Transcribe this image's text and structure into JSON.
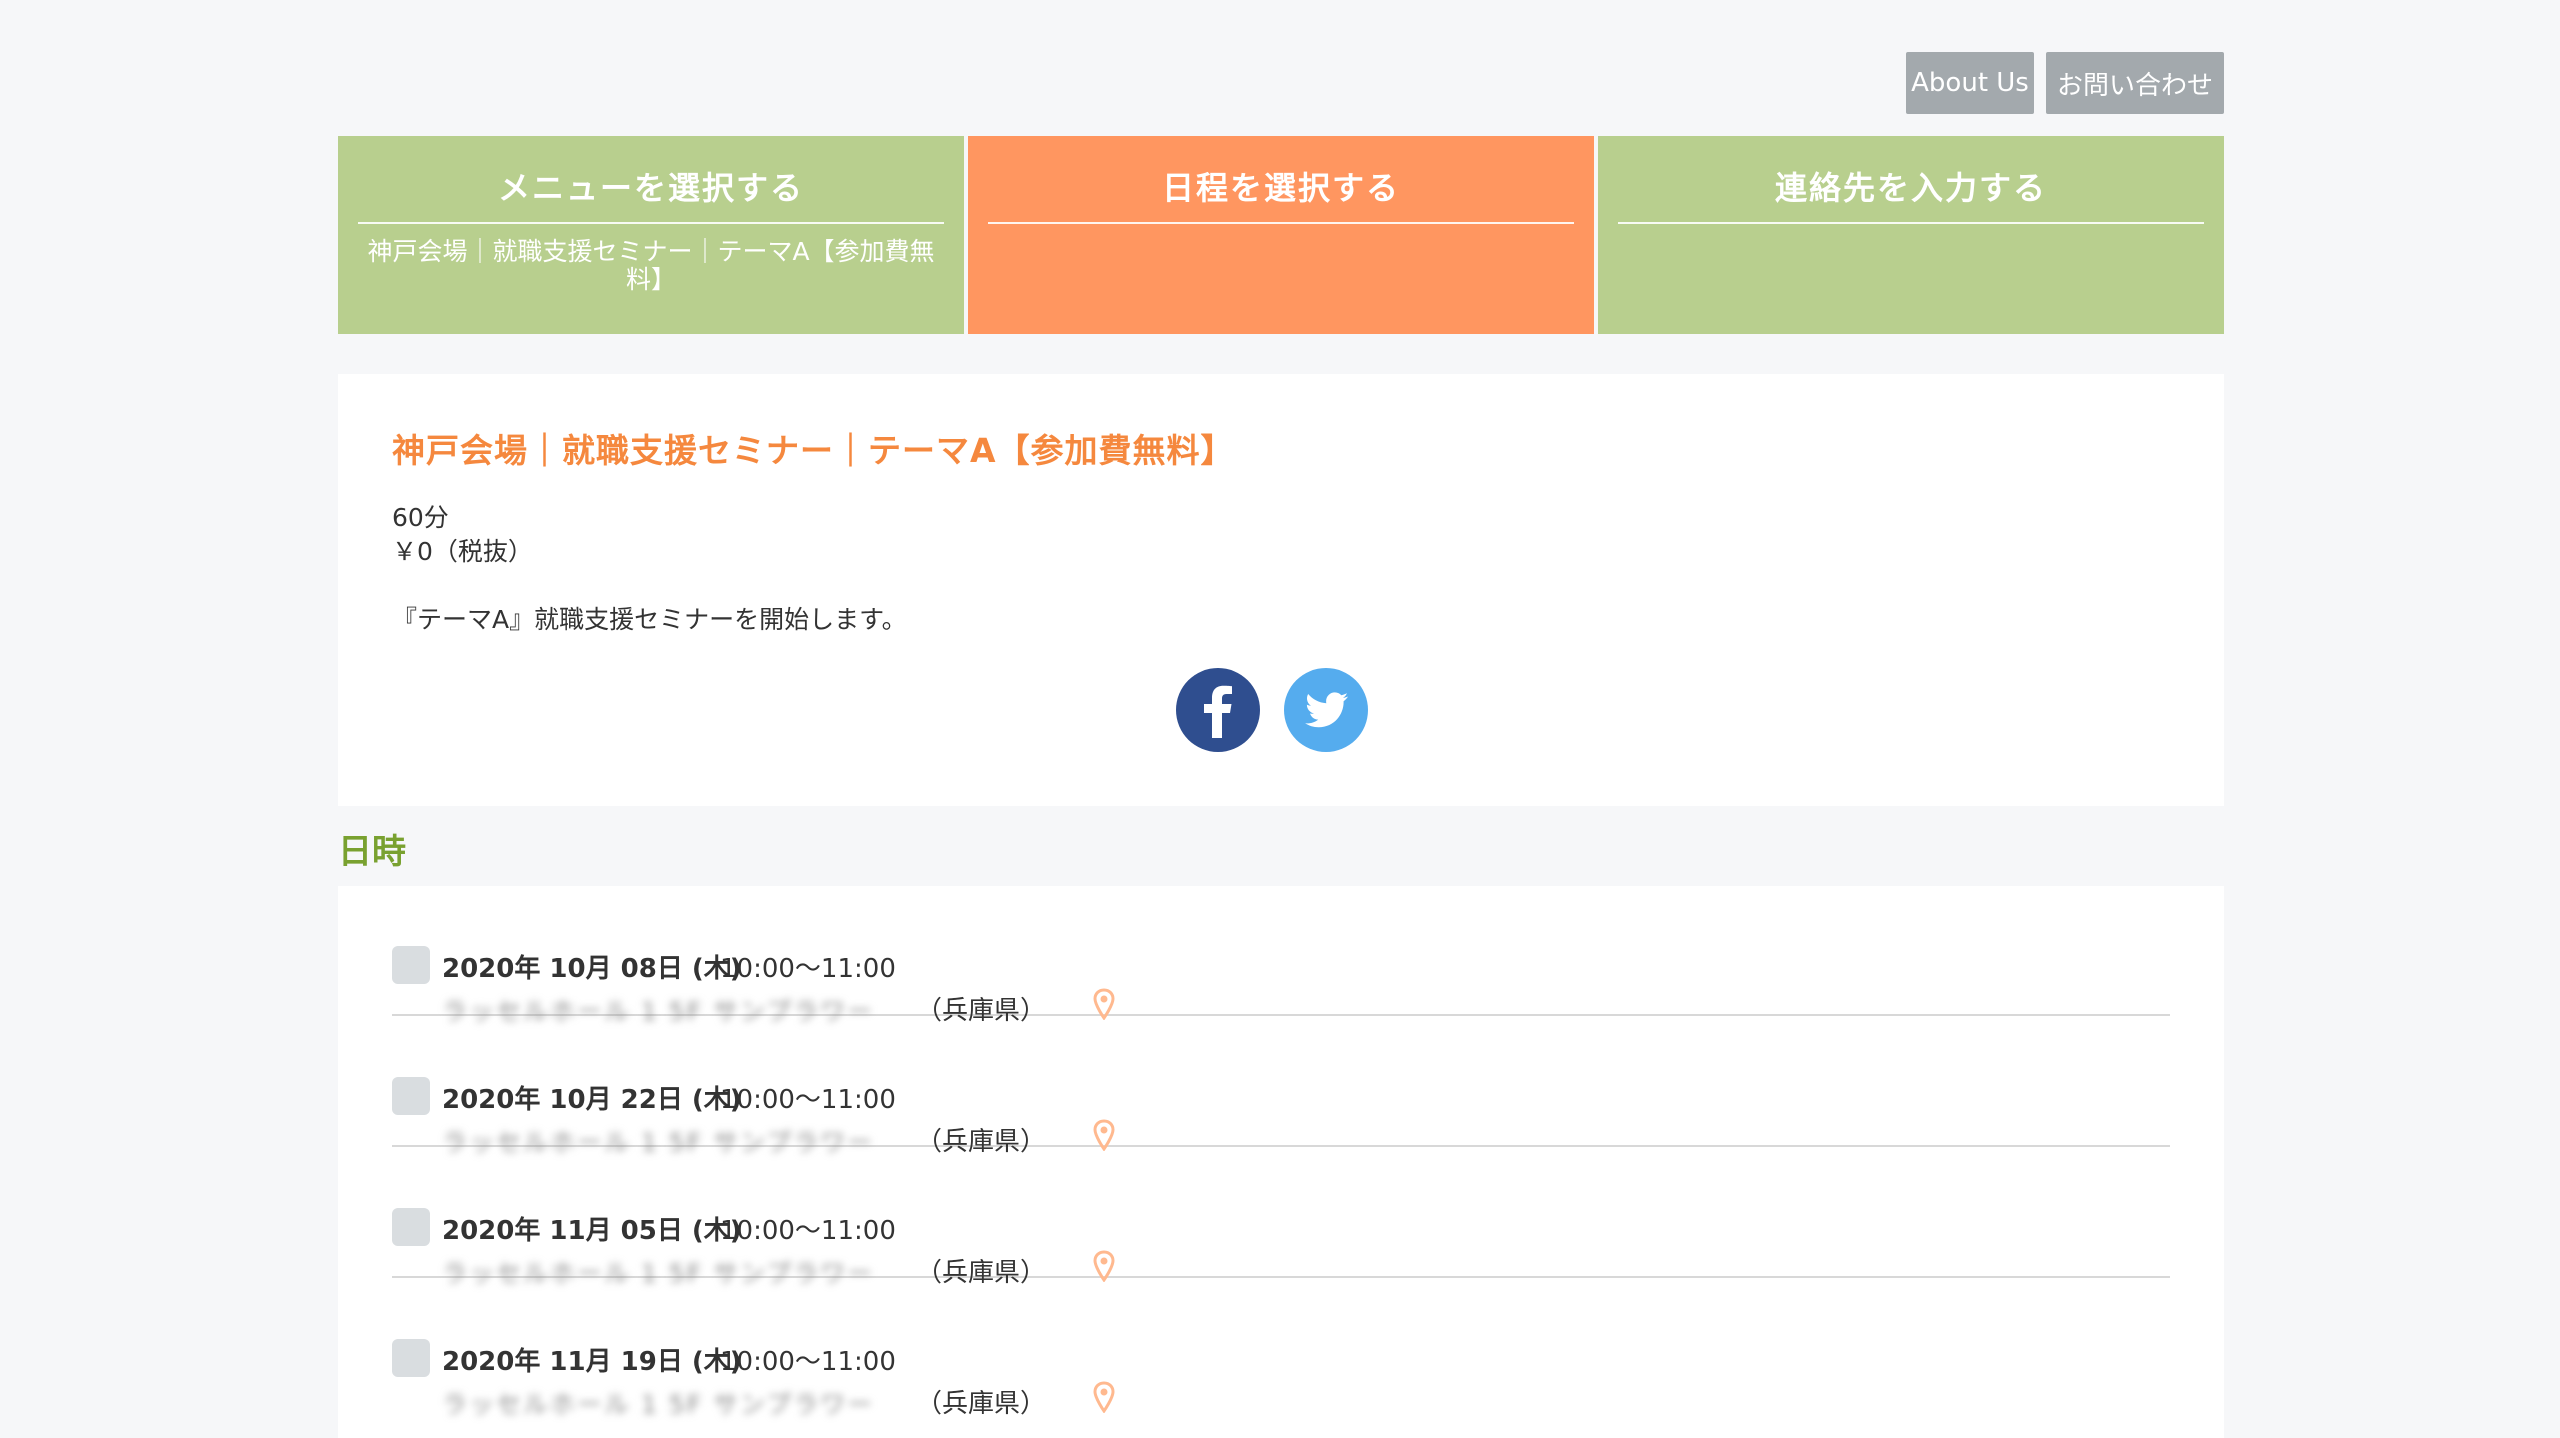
{
  "header": {
    "about_label": "About Us",
    "contact_label": "お問い合わせ"
  },
  "steps": [
    {
      "title": "メニューを選択する",
      "sub": "神戸会場｜就職支援セミナー｜テーマA【参加費無料】",
      "state": "done"
    },
    {
      "title": "日程を選択する",
      "sub": "",
      "state": "active"
    },
    {
      "title": "連絡先を入力する",
      "sub": "",
      "state": "pending"
    }
  ],
  "menu": {
    "title": "神戸会場｜就職支援セミナー｜テーマA【参加費無料】",
    "duration": "60分",
    "price": "￥0（税抜）",
    "description": "『テーマA』就職支援セミナーを開始します。",
    "social": [
      "facebook-icon",
      "twitter-icon"
    ]
  },
  "schedule": {
    "heading": "日時",
    "slots": [
      {
        "date": "2020年 10月 08日 (木)",
        "time": "10:00〜11:00",
        "venue": "ラッセルホール 1 5F サンプラワー",
        "prefecture": "（兵庫県）"
      },
      {
        "date": "2020年 10月 22日 (木)",
        "time": "10:00〜11:00",
        "venue": "ラッセルホール 1 5F サンプラワー",
        "prefecture": "（兵庫県）"
      },
      {
        "date": "2020年 11月 05日 (木)",
        "time": "10:00〜11:00",
        "venue": "ラッセルホール 1 5F サンプラワー",
        "prefecture": "（兵庫県）"
      },
      {
        "date": "2020年 11月 19日 (木)",
        "time": "10:00〜11:00",
        "venue": "ラッセルホール 1 5F サンプラワー",
        "prefecture": "（兵庫県）"
      }
    ]
  },
  "colors": {
    "step_done": "#b8cf8e",
    "step_active": "#ff9660",
    "title_orange": "#f5883e",
    "heading_green": "#79a130",
    "pin": "#ffb98f"
  }
}
